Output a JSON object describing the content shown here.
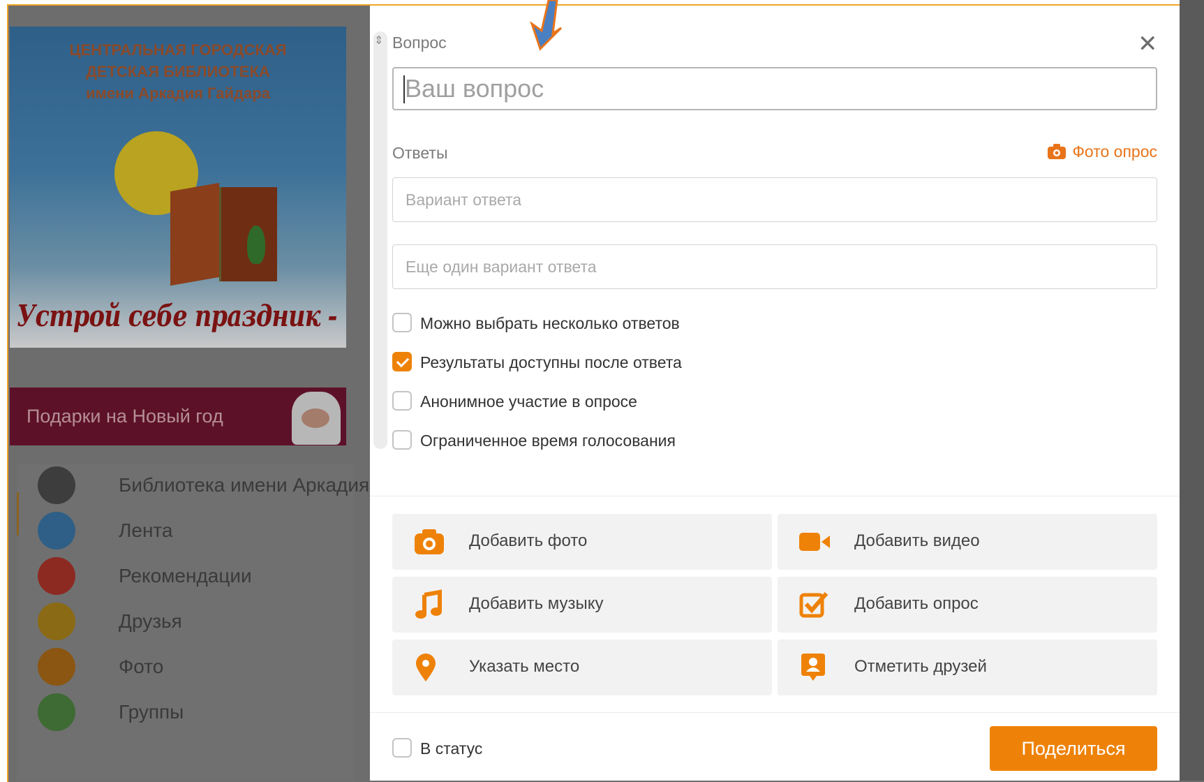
{
  "background_page": {
    "banner": {
      "title_lines": [
        "ЦЕНТРАЛЬНАЯ ГОРОДСКАЯ",
        "ДЕТСКАЯ БИБЛИОТЕКА",
        "имени Аркадия Гайдара"
      ],
      "slogan": "Устрой себе праздник - читай!"
    },
    "gift_banner": "Подарки на Новый год",
    "nav": [
      {
        "label": "Библиотека имени Аркадия",
        "icon": "profile-icon",
        "color": "#3d3d3d"
      },
      {
        "label": "Лента",
        "icon": "feed-icon",
        "color": "#2f5f86"
      },
      {
        "label": "Рекомендации",
        "icon": "compass-icon",
        "color": "#8c2a22"
      },
      {
        "label": "Друзья",
        "icon": "friends-icon",
        "color": "#8a6a14"
      },
      {
        "label": "Фото",
        "icon": "photo-icon",
        "color": "#8a5612"
      },
      {
        "label": "Группы",
        "icon": "groups-icon",
        "color": "#3e6a33"
      }
    ]
  },
  "modal": {
    "question_label": "Вопрос",
    "question_placeholder": "Ваш вопрос",
    "answers_label": "Ответы",
    "photo_poll_label": "Фото опрос",
    "answer_placeholders": [
      "Вариант ответа",
      "Еще один вариант ответа"
    ],
    "options": [
      {
        "label": "Можно выбрать несколько ответов",
        "checked": false
      },
      {
        "label": "Результаты доступны после ответа",
        "checked": true
      },
      {
        "label": "Анонимное участие в опросе",
        "checked": false
      },
      {
        "label": "Ограниченное время голосования",
        "checked": false
      }
    ],
    "actions": [
      {
        "label": "Добавить фото",
        "icon": "camera-icon"
      },
      {
        "label": "Добавить видео",
        "icon": "video-camera-icon"
      },
      {
        "label": "Добавить музыку",
        "icon": "music-note-icon"
      },
      {
        "label": "Добавить опрос",
        "icon": "poll-check-icon"
      },
      {
        "label": "Указать место",
        "icon": "location-pin-icon"
      },
      {
        "label": "Отметить друзей",
        "icon": "tag-friends-icon"
      }
    ],
    "status_label": "В статус",
    "status_checked": false,
    "share_label": "Поделиться"
  },
  "colors": {
    "accent": "#ee8208",
    "frame": "#f0a526",
    "annotation_arrow": "#4a7fc1"
  }
}
